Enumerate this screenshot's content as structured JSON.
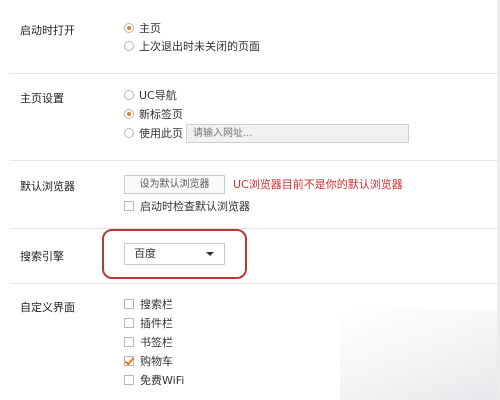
{
  "startup": {
    "label": "启动时打开",
    "options": [
      "主页",
      "上次退出时未关闭的页面"
    ],
    "selected": 0
  },
  "homepage": {
    "label": "主页设置",
    "options": [
      "UC导航",
      "新标签页",
      "使用此页"
    ],
    "selected": 1,
    "url_placeholder": "请输入网址..."
  },
  "default_browser": {
    "label": "默认浏览器",
    "button_label": "设为默认浏览器",
    "warning": "UC浏览器目前不是你的默认浏览器",
    "check_label": "启动时检查默认浏览器",
    "check_on": false
  },
  "search": {
    "label": "搜索引擎",
    "selected_engine": "百度"
  },
  "custom_ui": {
    "label": "自定义界面",
    "items": [
      {
        "label": "搜索栏",
        "checked": false
      },
      {
        "label": "插件栏",
        "checked": false
      },
      {
        "label": "书签栏",
        "checked": false
      },
      {
        "label": "购物车",
        "checked": true
      },
      {
        "label": "免费WiFi",
        "checked": false
      }
    ]
  },
  "colors": {
    "accent": "#f07a16",
    "warning": "#d0312d",
    "highlight_border": "#b23a3a"
  }
}
